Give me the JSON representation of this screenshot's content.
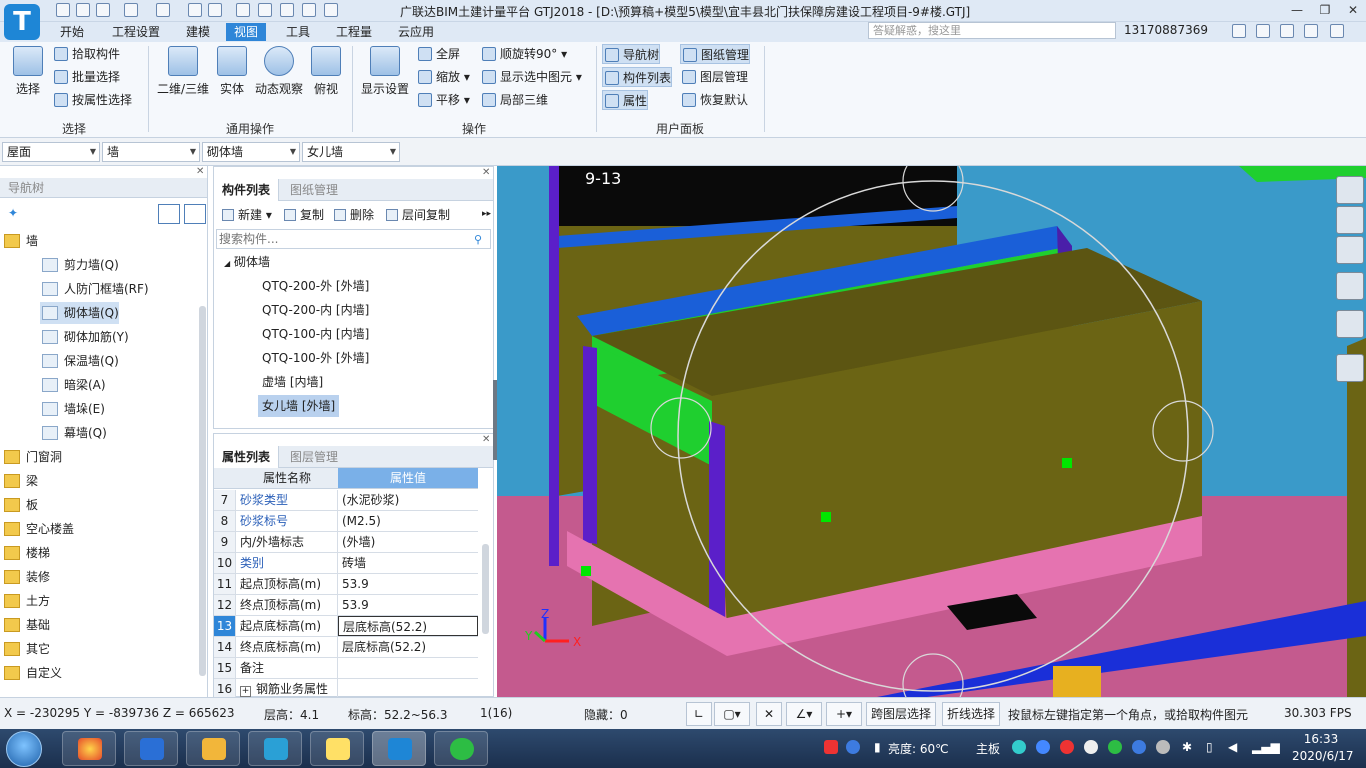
{
  "app": {
    "logo_letter": "T",
    "title": "广联达BIM土建计量平台 GTJ2018 - [D:\\预算稿+模型5\\模型\\宜丰县北门扶保障房建设工程项目-9#楼.GTJ]"
  },
  "menu": {
    "items": [
      "开始",
      "工程设置",
      "建模",
      "视图",
      "工具",
      "工程量",
      "云应用"
    ],
    "active": "视图"
  },
  "search": {
    "placeholder": "答疑解惑，搜这里"
  },
  "user": {
    "phone": "13170887369"
  },
  "ribbon": {
    "groups": {
      "select": "选择",
      "common": "通用操作",
      "operate": "操作",
      "panel": "用户面板"
    },
    "select_big": "选择",
    "pick": "拾取构件",
    "batch": "批量选择",
    "by_attr": "按属性选择",
    "view2d3d": "二维/三维",
    "solid": "实体",
    "dynamic": "动态观察",
    "topview": "俯视",
    "display": "显示设置",
    "fullscreen": "全屏",
    "zoom": "缩放",
    "pan": "平移",
    "rotate": "顺旋转90°",
    "show_selected": "显示选中图元",
    "local3d": "局部三维",
    "navtree": "导航树",
    "drawing_mgr": "图纸管理",
    "comp_list": "构件列表",
    "layer_mgr": "图层管理",
    "attr": "属性",
    "restore": "恢复默认"
  },
  "filters": [
    "屋面",
    "墙",
    "砌体墙",
    "女儿墙"
  ],
  "nav": {
    "title": "导航树",
    "items": [
      {
        "label": "墙",
        "type": "folder"
      },
      {
        "label": "剪力墙(Q)",
        "type": "leaf"
      },
      {
        "label": "人防门框墙(RF)",
        "type": "leaf"
      },
      {
        "label": "砌体墙(Q)",
        "type": "leaf",
        "selected": true
      },
      {
        "label": "砌体加筋(Y)",
        "type": "leaf"
      },
      {
        "label": "保温墙(Q)",
        "type": "leaf"
      },
      {
        "label": "暗梁(A)",
        "type": "leaf"
      },
      {
        "label": "墙垛(E)",
        "type": "leaf"
      },
      {
        "label": "幕墙(Q)",
        "type": "leaf"
      },
      {
        "label": "门窗洞",
        "type": "folder"
      },
      {
        "label": "梁",
        "type": "folder"
      },
      {
        "label": "板",
        "type": "folder"
      },
      {
        "label": "空心楼盖",
        "type": "folder"
      },
      {
        "label": "楼梯",
        "type": "folder"
      },
      {
        "label": "装修",
        "type": "folder"
      },
      {
        "label": "土方",
        "type": "folder"
      },
      {
        "label": "基础",
        "type": "folder"
      },
      {
        "label": "其它",
        "type": "folder"
      },
      {
        "label": "自定义",
        "type": "folder"
      }
    ]
  },
  "components": {
    "tabs": [
      "构件列表",
      "图纸管理"
    ],
    "toolbar": {
      "new": "新建",
      "copy": "复制",
      "delete": "删除",
      "floor_copy": "层间复制"
    },
    "search_placeholder": "搜索构件...",
    "group": "砌体墙",
    "items": [
      "QTQ-200-外 [外墙]",
      "QTQ-200-内 [内墙]",
      "QTQ-100-内 [内墙]",
      "QTQ-100-外 [外墙]",
      "虚墙 [内墙]",
      "女儿墙 [外墙]"
    ],
    "selected": "女儿墙 [外墙]"
  },
  "properties": {
    "tabs": [
      "属性列表",
      "图层管理"
    ],
    "header": {
      "name": "属性名称",
      "value": "属性值"
    },
    "rows": [
      {
        "no": "7",
        "name": "砂浆类型",
        "value": "(水泥砂浆)",
        "blue": true
      },
      {
        "no": "8",
        "name": "砂浆标号",
        "value": "(M2.5)",
        "blue": true
      },
      {
        "no": "9",
        "name": "内/外墙标志",
        "value": "(外墙)",
        "blue": false
      },
      {
        "no": "10",
        "name": "类别",
        "value": "砖墙",
        "blue": true
      },
      {
        "no": "11",
        "name": "起点顶标高(m)",
        "value": "53.9",
        "blue": false
      },
      {
        "no": "12",
        "name": "终点顶标高(m)",
        "value": "53.9",
        "blue": false
      },
      {
        "no": "13",
        "name": "起点底标高(m)",
        "value": "层底标高(52.2)",
        "blue": false,
        "active": true
      },
      {
        "no": "14",
        "name": "终点底标高(m)",
        "value": "层底标高(52.2)",
        "blue": false
      },
      {
        "no": "15",
        "name": "备注",
        "value": "",
        "blue": false
      },
      {
        "no": "16",
        "name": "钢筋业务属性",
        "value": "",
        "blue": false,
        "expand": "+"
      }
    ]
  },
  "viewport": {
    "axis_label": "9-13",
    "axes": {
      "x": "X",
      "y": "Y",
      "z": "Z"
    }
  },
  "status": {
    "coords": "X = -230295 Y = -839736 Z = 665623",
    "floor_height": "层高：4.1",
    "elevation": "标高：52.2~56.3",
    "count": "1(16)",
    "hidden": "隐藏：0",
    "cross_layer": "跨图层选择",
    "polyline": "折线选择",
    "hint": "按鼠标左键指定第一个角点，或拾取构件图元",
    "fps": "30.303 FPS"
  },
  "taskbar": {
    "brightness": "亮度: 60℃",
    "mainboard": "主板",
    "time": "16:33",
    "date": "2020/6/17"
  },
  "colors": {
    "accent": "#2f86d8",
    "viewport_bg": "#3a9ac9",
    "wall_olive": "#6b6414",
    "beam_blue": "#1a5fd8",
    "slab_pink": "#c45a8e",
    "green": "#1fcf2f",
    "purple": "#5b1fc9"
  }
}
